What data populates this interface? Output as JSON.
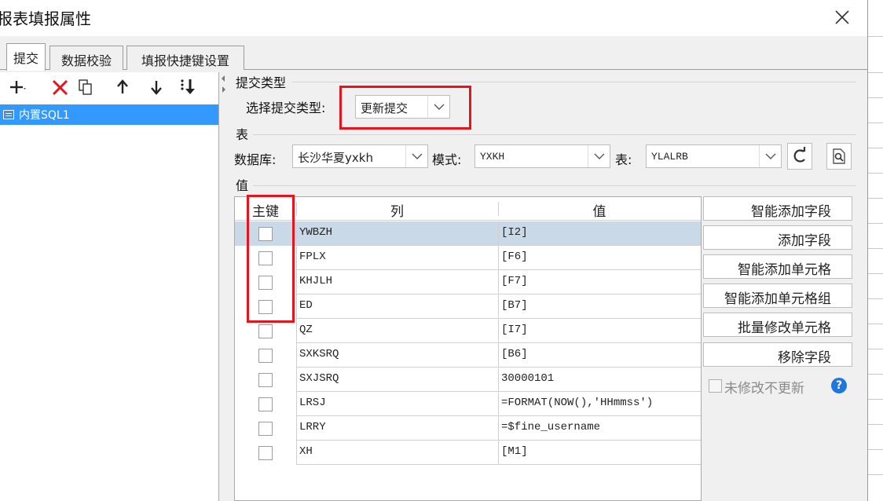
{
  "dialog": {
    "title": "报表填报属性",
    "close_icon": "close-icon"
  },
  "tabs": [
    {
      "label": "提交",
      "active": true
    },
    {
      "label": "数据校验",
      "active": false
    },
    {
      "label": "填报快捷键设置",
      "active": false
    }
  ],
  "toolbar": {
    "icons": [
      "add-icon",
      "delete-icon",
      "copy-icon",
      "move-up-icon",
      "move-down-icon",
      "sort-icon"
    ]
  },
  "tree": {
    "items": [
      {
        "label": "内置SQL1",
        "selected": true
      }
    ]
  },
  "submit_type": {
    "section": "提交类型",
    "label": "选择提交类型:",
    "value": "更新提交"
  },
  "table_section": {
    "section": "表",
    "db_label": "数据库:",
    "db_value": "长沙华夏yxkh",
    "schema_label": "模式:",
    "schema_value": "YXKH",
    "table_label": "表:",
    "table_value": "YLALRB",
    "refresh_icon": "refresh-icon",
    "preview_icon": "preview-icon"
  },
  "value_section": {
    "section": "值",
    "headers": {
      "key": "主键",
      "column": "列",
      "value": "值"
    },
    "rows": [
      {
        "column": "YWBZH",
        "value": "[I2]",
        "selected": true
      },
      {
        "column": "FPLX",
        "value": "[F6]"
      },
      {
        "column": "KHJLH",
        "value": "[F7]"
      },
      {
        "column": "ED",
        "value": "[B7]"
      },
      {
        "column": "QZ",
        "value": "[I7]"
      },
      {
        "column": "SXKSRQ",
        "value": "[B6]"
      },
      {
        "column": "SXJSRQ",
        "value": "30000101"
      },
      {
        "column": "LRSJ",
        "value": "=FORMAT(NOW(),'HHmmss')"
      },
      {
        "column": "LRRY",
        "value": "=$fine_username"
      },
      {
        "column": "XH",
        "value": "[M1]"
      }
    ]
  },
  "actions": {
    "smart_add_field": "智能添加字段",
    "add_field": "添加字段",
    "smart_add_cell": "智能添加单元格",
    "smart_add_cell_group": "智能添加单元格组",
    "batch_modify_cell": "批量修改单元格",
    "remove_field": "移除字段",
    "no_update_unmodified": "未修改不更新",
    "help_icon": "help-icon"
  },
  "colors": {
    "highlight": "#e8141b",
    "selection": "#3399ff",
    "row_selected": "#cad9e8"
  }
}
